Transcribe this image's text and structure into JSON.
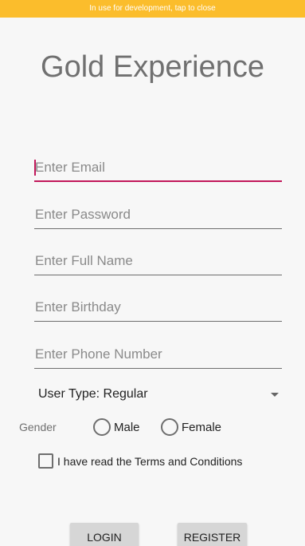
{
  "dev_banner": {
    "text": "In use for development, tap to close"
  },
  "app": {
    "title": "Gold Experience"
  },
  "form": {
    "email": {
      "placeholder": "Enter Email",
      "value": ""
    },
    "password": {
      "placeholder": "Enter Password",
      "value": ""
    },
    "full_name": {
      "placeholder": "Enter Full Name",
      "value": ""
    },
    "birthday": {
      "placeholder": "Enter Birthday",
      "value": ""
    },
    "phone": {
      "placeholder": "Enter Phone Number",
      "value": ""
    },
    "user_type": {
      "selected": "User Type: Regular"
    },
    "gender": {
      "label": "Gender",
      "options": [
        "Male",
        "Female"
      ],
      "selected": null
    },
    "terms": {
      "label": "I have read the Terms and Conditions",
      "checked": false
    }
  },
  "buttons": {
    "login": "LOGIN",
    "register": "REGISTER"
  },
  "colors": {
    "banner": "#fbbd2c",
    "accent": "#c2185b",
    "title": "#707070",
    "button_bg": "#d6d6d6"
  }
}
